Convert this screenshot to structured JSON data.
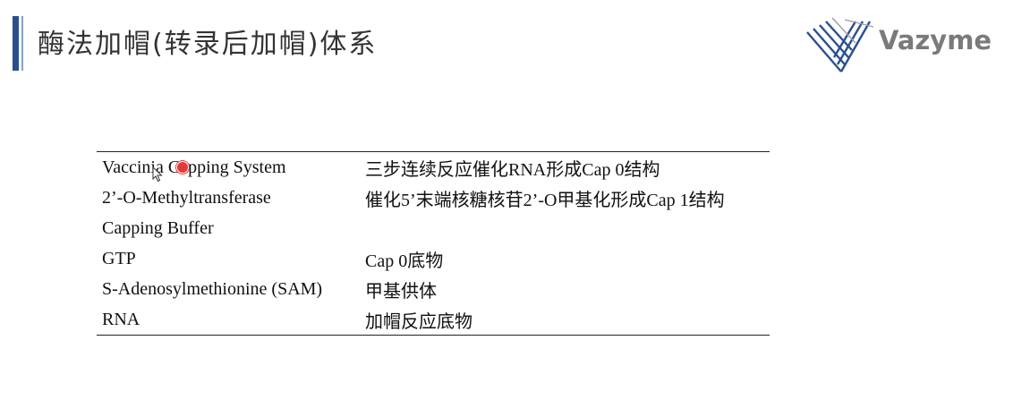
{
  "header": {
    "title": "酶法加帽(转录后加帽)体系"
  },
  "logo": {
    "text": "Vazyme",
    "icon": "vazyme-logo-icon"
  },
  "table": {
    "rows": [
      {
        "component": "Vaccinia Capping System",
        "description": "三步连续反应催化RNA形成Cap 0结构"
      },
      {
        "component": "2’-O-Methyltransferase",
        "description": "催化5’末端核糖核苷2’-O甲基化形成Cap 1结构"
      },
      {
        "component": "Capping Buffer",
        "description": ""
      },
      {
        "component": "GTP",
        "description": "Cap 0底物"
      },
      {
        "component": "S-Adenosylmethionine (SAM)",
        "description": "甲基供体"
      },
      {
        "component": "RNA",
        "description": "加帽反应底物"
      }
    ]
  },
  "colors": {
    "accent_bar": "#2a4f8f",
    "logo_blue": "#2a4f8f",
    "logo_text": "#7a7a7a",
    "pointer": "#e03c3c"
  }
}
